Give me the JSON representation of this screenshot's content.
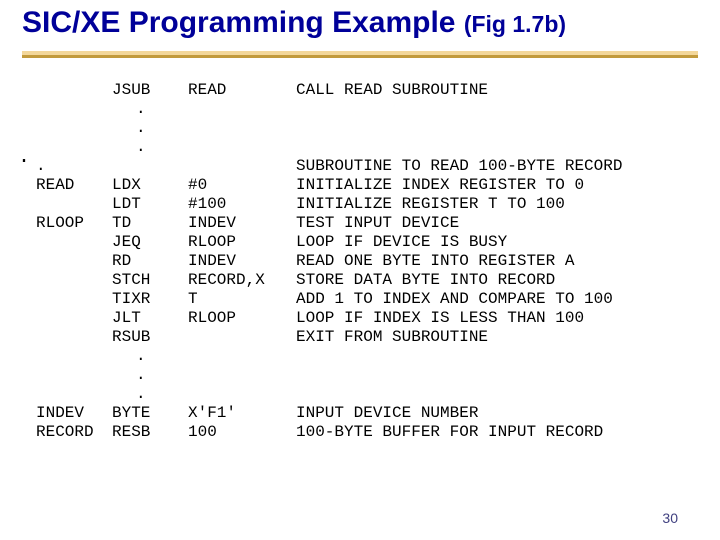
{
  "title_main": "SIC/XE Programming Example",
  "title_sub": "(Fig 1.7b)",
  "page_number": "30",
  "rows": [
    {
      "label": "",
      "opcode": "JSUB",
      "operand": "READ",
      "comment": "CALL READ SUBROUTINE"
    },
    {
      "dots": true
    },
    {
      "dots": true
    },
    {
      "dots": true
    },
    {
      "label": ".",
      "opcode": "",
      "operand": "",
      "comment": "SUBROUTINE TO READ 100-BYTE RECORD",
      "leftdot": true
    },
    {
      "label": "READ",
      "opcode": "LDX",
      "operand": "#0",
      "comment": "INITIALIZE INDEX REGISTER TO 0"
    },
    {
      "label": "",
      "opcode": "LDT",
      "operand": "#100",
      "comment": "INITIALIZE REGISTER T TO 100"
    },
    {
      "label": "RLOOP",
      "opcode": "TD",
      "operand": "INDEV",
      "comment": "TEST INPUT DEVICE"
    },
    {
      "label": "",
      "opcode": "JEQ",
      "operand": "RLOOP",
      "comment": "LOOP IF DEVICE IS BUSY"
    },
    {
      "label": "",
      "opcode": "RD",
      "operand": "INDEV",
      "comment": "READ ONE BYTE INTO REGISTER A"
    },
    {
      "label": "",
      "opcode": "STCH",
      "operand": "RECORD,X",
      "comment": "STORE DATA BYTE INTO RECORD"
    },
    {
      "label": "",
      "opcode": "TIXR",
      "operand": "T",
      "comment": "ADD 1 TO INDEX AND COMPARE TO 100"
    },
    {
      "label": "",
      "opcode": "JLT",
      "operand": "RLOOP",
      "comment": "LOOP IF INDEX IS LESS THAN 100"
    },
    {
      "label": "",
      "opcode": "RSUB",
      "operand": "",
      "comment": "EXIT FROM SUBROUTINE"
    },
    {
      "dots": true
    },
    {
      "dots": true
    },
    {
      "dots": true
    },
    {
      "label": "INDEV",
      "opcode": "BYTE",
      "operand": "X'F1'",
      "comment": "INPUT DEVICE NUMBER"
    },
    {
      "label": "RECORD",
      "opcode": "RESB",
      "operand": "100",
      "comment": "100-BYTE BUFFER FOR INPUT RECORD"
    }
  ]
}
